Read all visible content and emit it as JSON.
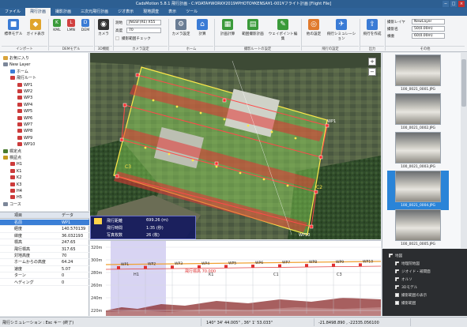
{
  "window": {
    "title": "CadsMotion 5.8.1 飛行計画 - C:¥DATA¥WORK¥2019¥PHOTO¥KENSA¥1-001¥フライト計画 [Flight File]"
  },
  "menu": [
    "ファイル",
    "飛行計画",
    "撮影計画",
    "三次元飛行計画",
    "ジオ表示",
    "現地調査",
    "表示",
    "ツール"
  ],
  "menu_active_index": 1,
  "ribbon": {
    "buttons": {
      "std_model": "標準モデル",
      "guide_model": "ガイド表示",
      "kml": "KML",
      "lmn": "LMN",
      "dem": "DEM",
      "camera": "カメラ",
      "camera_settings": "カメラ設定",
      "calc": "計算",
      "plan_compute": "計画計算",
      "range_plan": "範囲撮影計画",
      "waypoint": "ウェイポイント編集",
      "alt_settings": "他の設定",
      "sim": "飛行シミュレーション",
      "export": "飛行を作成"
    },
    "groups": {
      "import": "インポート",
      "dem_group": "DEMモデル",
      "camera_group": "3D機能",
      "plan_group": "カメラ設定",
      "home_group": "ホーム",
      "route_group": "撮影ルートの設定",
      "route_group2": "飛行の設定",
      "output_group": "出力",
      "misc_group": "その他"
    },
    "fields": {
      "datum_label": "測地",
      "datum_value": "JNGSF(RE)  X55",
      "alt_label": "高度",
      "alt_value": "70",
      "terrain_check": "撮影範囲チェック",
      "layer_label": "撮影レイヤ",
      "layer_value": "NewLayer",
      "overlap_label": "撮影名",
      "overlap_value": "50(0.00m)",
      "sidelap_label": "横重",
      "sidelap_value": "60(0.00m)"
    }
  },
  "tree": {
    "nodes": [
      {
        "label": "お気に入り",
        "level": 0,
        "icon_color": "#d9a33a"
      },
      {
        "label": "New Layer",
        "level": 0,
        "icon_color": "#7c8799"
      },
      {
        "label": "ホーム",
        "level": 1,
        "icon_color": "#3a7bd5"
      },
      {
        "label": "飛行ルート",
        "level": 1,
        "icon_color": "#cc3b3b"
      },
      {
        "label": "WP1",
        "level": 2,
        "icon_color": "#cc3b3b"
      },
      {
        "label": "WP2",
        "level": 2,
        "icon_color": "#cc3b3b"
      },
      {
        "label": "WP3",
        "level": 2,
        "icon_color": "#cc3b3b"
      },
      {
        "label": "WP4",
        "level": 2,
        "icon_color": "#cc3b3b"
      },
      {
        "label": "WP5",
        "level": 2,
        "icon_color": "#cc3b3b"
      },
      {
        "label": "WP6",
        "level": 2,
        "icon_color": "#cc3b3b"
      },
      {
        "label": "WP7",
        "level": 2,
        "icon_color": "#cc3b3b"
      },
      {
        "label": "WP8",
        "level": 2,
        "icon_color": "#cc3b3b"
      },
      {
        "label": "WP9",
        "level": 2,
        "icon_color": "#cc3b3b"
      },
      {
        "label": "WP10",
        "level": 2,
        "icon_color": "#cc3b3b"
      },
      {
        "label": "標定点",
        "level": 0,
        "icon_color": "#4a7a2e"
      },
      {
        "label": "検証点",
        "level": 0,
        "icon_color": "#c59a1e"
      },
      {
        "label": "H1",
        "level": 1,
        "icon_color": "#cc3b3b"
      },
      {
        "label": "K1",
        "level": 1,
        "icon_color": "#cc3b3b"
      },
      {
        "label": "K2",
        "level": 1,
        "icon_color": "#cc3b3b"
      },
      {
        "label": "K3",
        "level": 1,
        "icon_color": "#cc3b3b"
      },
      {
        "label": "H4",
        "level": 1,
        "icon_color": "#cc3b3b"
      },
      {
        "label": "H5",
        "level": 1,
        "icon_color": "#cc3b3b"
      },
      {
        "label": "コース",
        "level": 0,
        "icon_color": "#7c8799"
      }
    ]
  },
  "properties": {
    "header": [
      "項目",
      "データ"
    ],
    "rows": [
      {
        "name": "名前",
        "value": "WP1",
        "selected": true
      },
      {
        "name": "経度",
        "value": "140.570139",
        "selected": false
      },
      {
        "name": "緯度",
        "value": "36.032193",
        "selected": false
      },
      {
        "name": "標高",
        "value": "247.65",
        "selected": false
      },
      {
        "name": "飛行標高",
        "value": "317.65",
        "selected": false
      },
      {
        "name": "対地高度",
        "value": "70",
        "selected": false
      },
      {
        "name": "ホームからの高度",
        "value": "64.24",
        "selected": false
      },
      {
        "name": "速度",
        "value": "5.07",
        "selected": false
      },
      {
        "name": "ターン",
        "value": "0",
        "selected": false
      },
      {
        "name": "ヘディング",
        "value": "0",
        "selected": false
      }
    ]
  },
  "map_info": {
    "distance_label": "飛行距離",
    "distance_value": "699.26 (m)",
    "time_label": "飛行時間",
    "time_value": "1:35 (秒)",
    "photos_label": "写真枚数",
    "photos_value": "26 (枚)"
  },
  "map_labels": [
    "C3",
    "C2",
    "WP1",
    "WP10"
  ],
  "profile": {
    "y_ticks": [
      "320m",
      "300m",
      "280m",
      "260m",
      "240m",
      "220m"
    ],
    "wp_labels": [
      "WP1",
      "WP2",
      "WP3",
      "WP4",
      "WP5",
      "WP6",
      "WP7",
      "WP8",
      "WP9",
      "WP10"
    ],
    "annotations": [
      "H1",
      "K1",
      "C1",
      "C3"
    ],
    "note": "飛行標高 70.000"
  },
  "thumbnails": [
    {
      "caption": "100_0021_0001.JPG",
      "selected": false
    },
    {
      "caption": "100_0021_0002.JPG",
      "selected": false
    },
    {
      "caption": "100_0021_0003.JPG",
      "selected": false
    },
    {
      "caption": "100_0021_0004.JPG",
      "selected": true
    },
    {
      "caption": "100_0021_0005.JPG",
      "selected": false
    }
  ],
  "layers": {
    "root": "地図",
    "items": [
      {
        "label": "地理院地図",
        "checked": true
      },
      {
        "label": "ジオイド・補間面",
        "checked": true
      },
      {
        "label": "オルソ",
        "checked": true
      },
      {
        "label": "3Dモデル",
        "checked": true
      },
      {
        "label": "撮影範囲の表示",
        "checked": false
      },
      {
        "label": "撮影範囲",
        "checked": false
      }
    ]
  },
  "status": {
    "left": "飛行シミュレーション : Esc キー (終了)",
    "coords": "140° 34' 44.005\" , 36° 1' 53.033\"",
    "xy": "-21.8498.890 , -22335.056100"
  },
  "colors": {
    "accent": "#2f6399",
    "selection": "#2a84d8",
    "route": "#e33434",
    "area": "#8bdc3a"
  }
}
